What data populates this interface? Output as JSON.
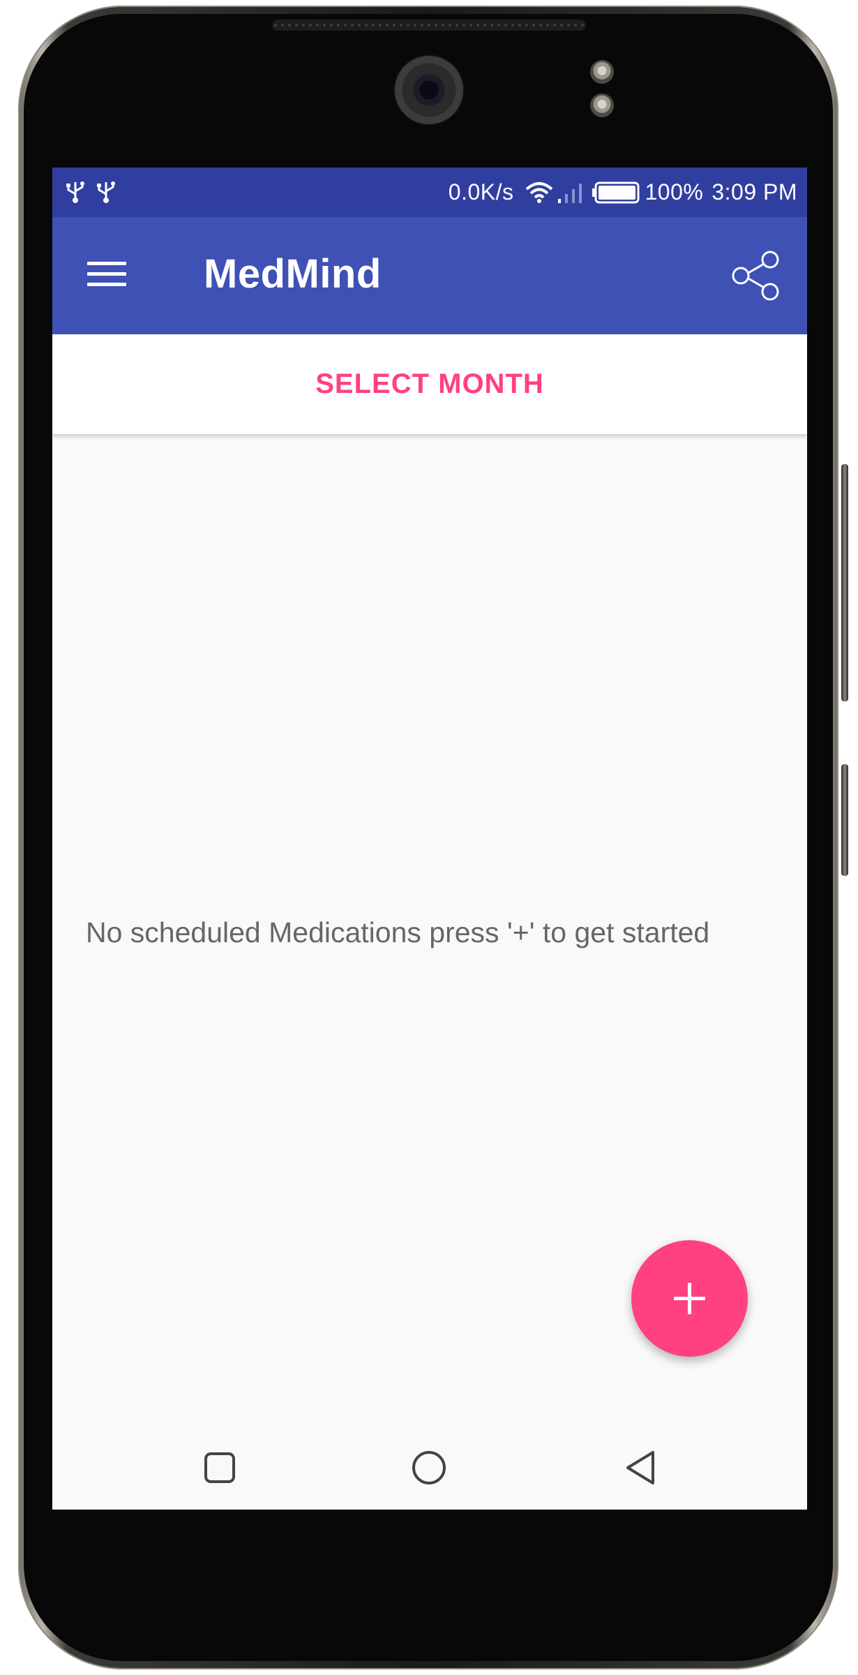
{
  "status_bar": {
    "network_speed": "0.0K/s",
    "battery_percent": "100%",
    "time": "3:09 PM",
    "icons": [
      "usb-icon",
      "usb-icon",
      "wifi-icon",
      "cell-signal-icon",
      "battery-icon"
    ],
    "background_color": "#303f9f"
  },
  "app_bar": {
    "title": "MedMind",
    "menu_icon": "hamburger-menu-icon",
    "share_icon": "share-icon",
    "background_color": "#3f51b5"
  },
  "month_selector": {
    "label": "SELECT MONTH",
    "color": "#ff4081"
  },
  "main": {
    "empty_message": "No scheduled Medications press '+' to get started"
  },
  "fab": {
    "icon": "plus-icon",
    "color": "#ff4081"
  },
  "nav_bar": {
    "buttons": [
      "recents-icon",
      "home-icon",
      "back-icon"
    ]
  }
}
